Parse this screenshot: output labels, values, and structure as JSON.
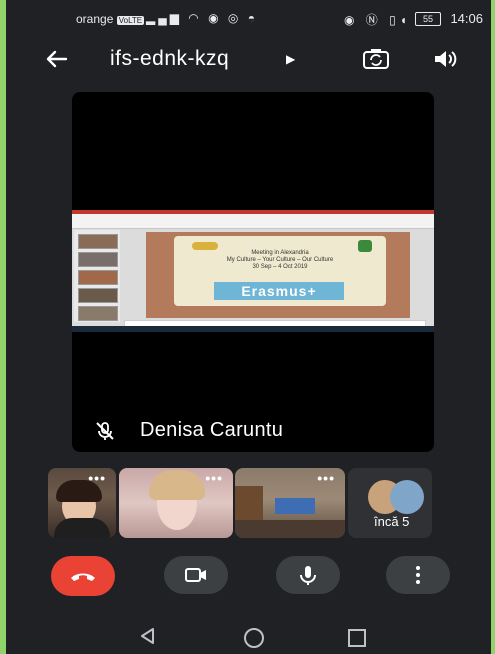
{
  "status_bar": {
    "carrier": "orange",
    "network_badge": "VoLTE",
    "battery": "55",
    "time": "14:06"
  },
  "call": {
    "meeting_code": "ifs-ednk-kzq",
    "back_icon": "arrow-left-icon",
    "switch_camera_icon": "camera-switch-icon",
    "speaker_icon": "volume-icon"
  },
  "main_tile": {
    "speaker_name": "Denisa Caruntu",
    "mic_state": "muted",
    "shared_slide": {
      "title_lines": [
        "Meeting in Alexandria",
        "My Culture – Your Culture – Our Culture",
        "30 Sep – 4 Oct 2019"
      ],
      "banner": "Erasmus+"
    }
  },
  "participants": {
    "more_options_label": "•••",
    "more_count_label": "încă 5"
  },
  "controls": {
    "hangup_icon": "end-call-icon",
    "camera_icon": "video-camera-icon",
    "mic_icon": "microphone-icon",
    "more_icon": "more-vertical-icon",
    "accent_red": "#ea4335",
    "button_gray": "#3c4043"
  },
  "nav_bar": {
    "back_icon": "triangle-back-icon",
    "home_icon": "circle-home-icon",
    "recents_icon": "square-recents-icon"
  }
}
